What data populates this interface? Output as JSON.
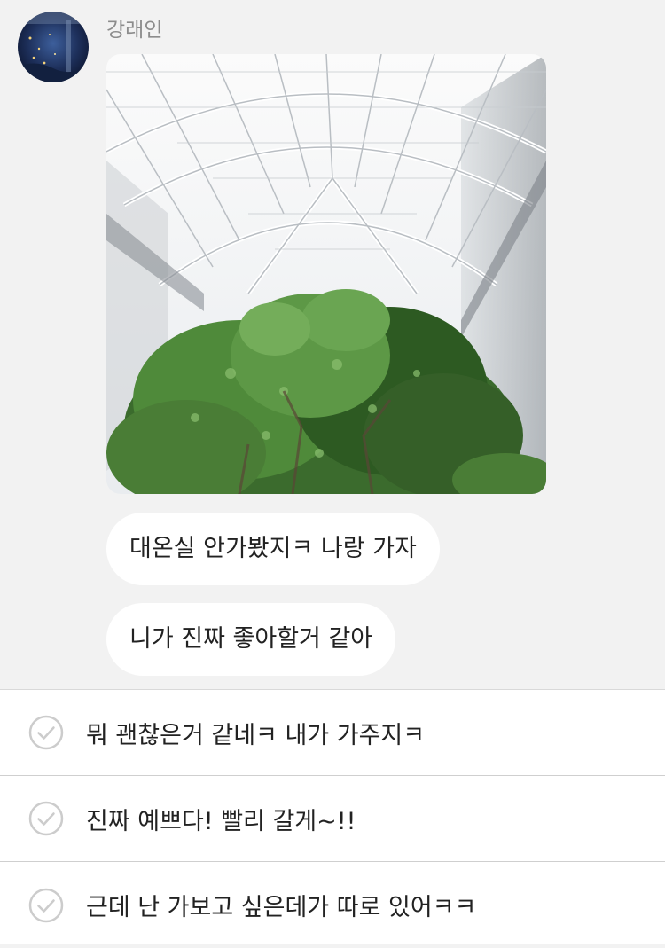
{
  "message": {
    "sender_name": "강래인",
    "avatar_icon": "profile-photo-icon",
    "bubbles": [
      "대온실 안가봤지ㅋ 나랑 가자",
      "니가 진짜 좋아할거 같아"
    ]
  },
  "quick_replies": [
    {
      "text": "뭐 괜찮은거 같네ㅋ 내가 가주지ㅋ",
      "icon": "check-circle-icon"
    },
    {
      "text": "진짜 예쁘다! 빨리 갈게~!!",
      "icon": "check-circle-icon"
    },
    {
      "text": "근데 난 가보고 싶은데가 따로 있어ㅋㅋ",
      "icon": "check-circle-icon"
    }
  ],
  "colors": {
    "chat_background": "#f2f2f2",
    "bubble_background": "#ffffff",
    "text": "#222222",
    "sender": "#8c8c8c",
    "check_outline": "#cccccc"
  }
}
